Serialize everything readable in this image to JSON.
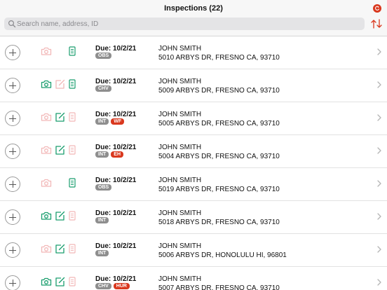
{
  "header": {
    "title": "Inspections (22)",
    "sync_icon": "refresh-icon",
    "sort_icon": "sort-arrows-icon"
  },
  "search": {
    "placeholder": "Search name, address, ID",
    "value": ""
  },
  "colors": {
    "active_icon": "#1a9e6e",
    "inactive_icon": "#f2b8b8",
    "badge_gray": "#8e8e8e",
    "badge_red": "#d9381e",
    "sync_button": "#d9381e"
  },
  "rows": [
    {
      "due": "Due: 10/2/21",
      "badges": [
        {
          "text": "OBS",
          "color": "gray"
        }
      ],
      "name": "JOHN SMITH",
      "address": "5010 ARBYS DR, FRESNO CA, 93710",
      "camera_active": false,
      "edit_active": null,
      "doc_active": true
    },
    {
      "due": "Due: 10/2/21",
      "badges": [
        {
          "text": "CHV",
          "color": "gray"
        }
      ],
      "name": "JOHN SMITH",
      "address": "5009 ARBYS DR, FRESNO CA, 93710",
      "camera_active": true,
      "edit_active": false,
      "doc_active": true
    },
    {
      "due": "Due: 10/2/21",
      "badges": [
        {
          "text": "INT",
          "color": "gray"
        },
        {
          "text": "WF",
          "color": "red"
        }
      ],
      "name": "JOHN SMITH",
      "address": "5005 ARBYS DR, FRESNO CA, 93710",
      "camera_active": false,
      "edit_active": true,
      "doc_active": false
    },
    {
      "due": "Due: 10/2/21",
      "badges": [
        {
          "text": "INT",
          "color": "gray"
        },
        {
          "text": "EH",
          "color": "red"
        }
      ],
      "name": "JOHN SMITH",
      "address": "5004 ARBYS DR, FRESNO CA, 93710",
      "camera_active": false,
      "edit_active": true,
      "doc_active": false
    },
    {
      "due": "Due: 10/2/21",
      "badges": [
        {
          "text": "OBS",
          "color": "gray"
        }
      ],
      "name": "JOHN SMITH",
      "address": "5019 ARBYS DR, FRESNO CA, 93710",
      "camera_active": false,
      "edit_active": null,
      "doc_active": true
    },
    {
      "due": "Due: 10/2/21",
      "badges": [
        {
          "text": "INT",
          "color": "gray"
        }
      ],
      "name": "JOHN SMITH",
      "address": "5018 ARBYS DR, FRESNO CA, 93710",
      "camera_active": true,
      "edit_active": true,
      "doc_active": false
    },
    {
      "due": "Due: 10/2/21",
      "badges": [
        {
          "text": "INT",
          "color": "gray"
        }
      ],
      "name": "JOHN SMITH",
      "address": "5006 ARBYS DR, HONOLULU HI, 96801",
      "camera_active": false,
      "edit_active": true,
      "doc_active": false
    },
    {
      "due": "Due: 10/2/21",
      "badges": [
        {
          "text": "CHV",
          "color": "gray"
        },
        {
          "text": "HUR",
          "color": "red"
        }
      ],
      "name": "JOHN SMITH",
      "address": "5007 ARBYS DR, FRESNO CA, 93710",
      "camera_active": true,
      "edit_active": true,
      "doc_active": false
    }
  ]
}
